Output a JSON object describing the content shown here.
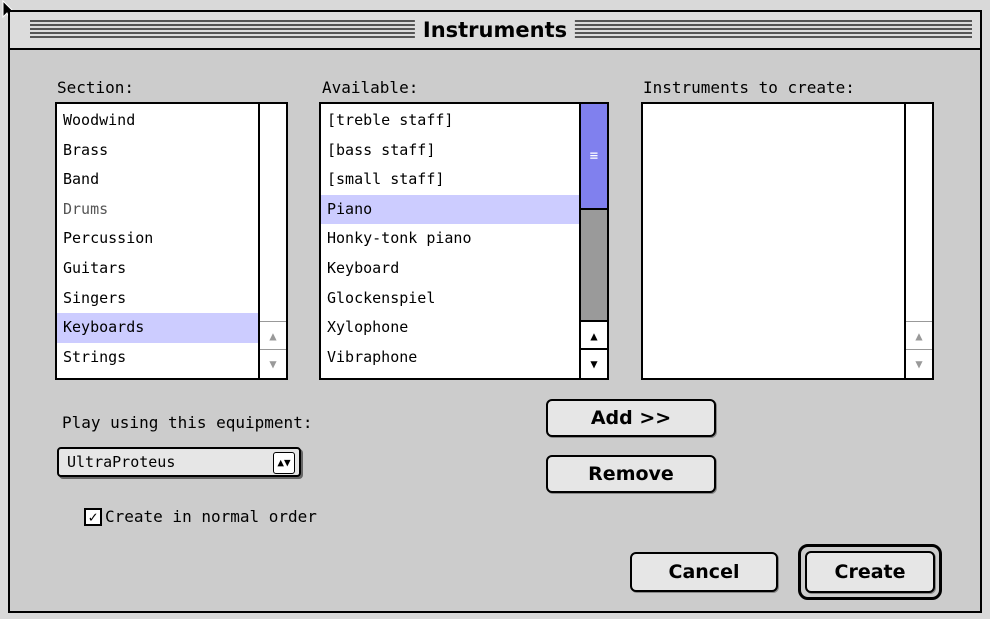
{
  "window": {
    "title": "Instruments"
  },
  "section": {
    "label": "Section:",
    "items": [
      "Woodwind",
      "Brass",
      "Band",
      "Drums",
      "Percussion",
      "Guitars",
      "Singers",
      "Keyboards",
      "Strings"
    ],
    "selected": "Keyboards"
  },
  "available": {
    "label": "Available:",
    "items": [
      "[treble staff]",
      "[bass staff]",
      "[small staff]",
      "Piano",
      "Honky-tonk piano",
      "Keyboard",
      "Glockenspiel",
      "Xylophone",
      "Vibraphone"
    ],
    "selected": "Piano"
  },
  "to_create": {
    "label": "Instruments to create:",
    "items": []
  },
  "equipment": {
    "label": "Play using this equipment:",
    "value": "UltraProteus"
  },
  "options": {
    "create_normal_order_label": "Create in normal order",
    "create_normal_order_checked": true
  },
  "buttons": {
    "add": "Add >>",
    "remove": "Remove",
    "cancel": "Cancel",
    "create": "Create"
  }
}
